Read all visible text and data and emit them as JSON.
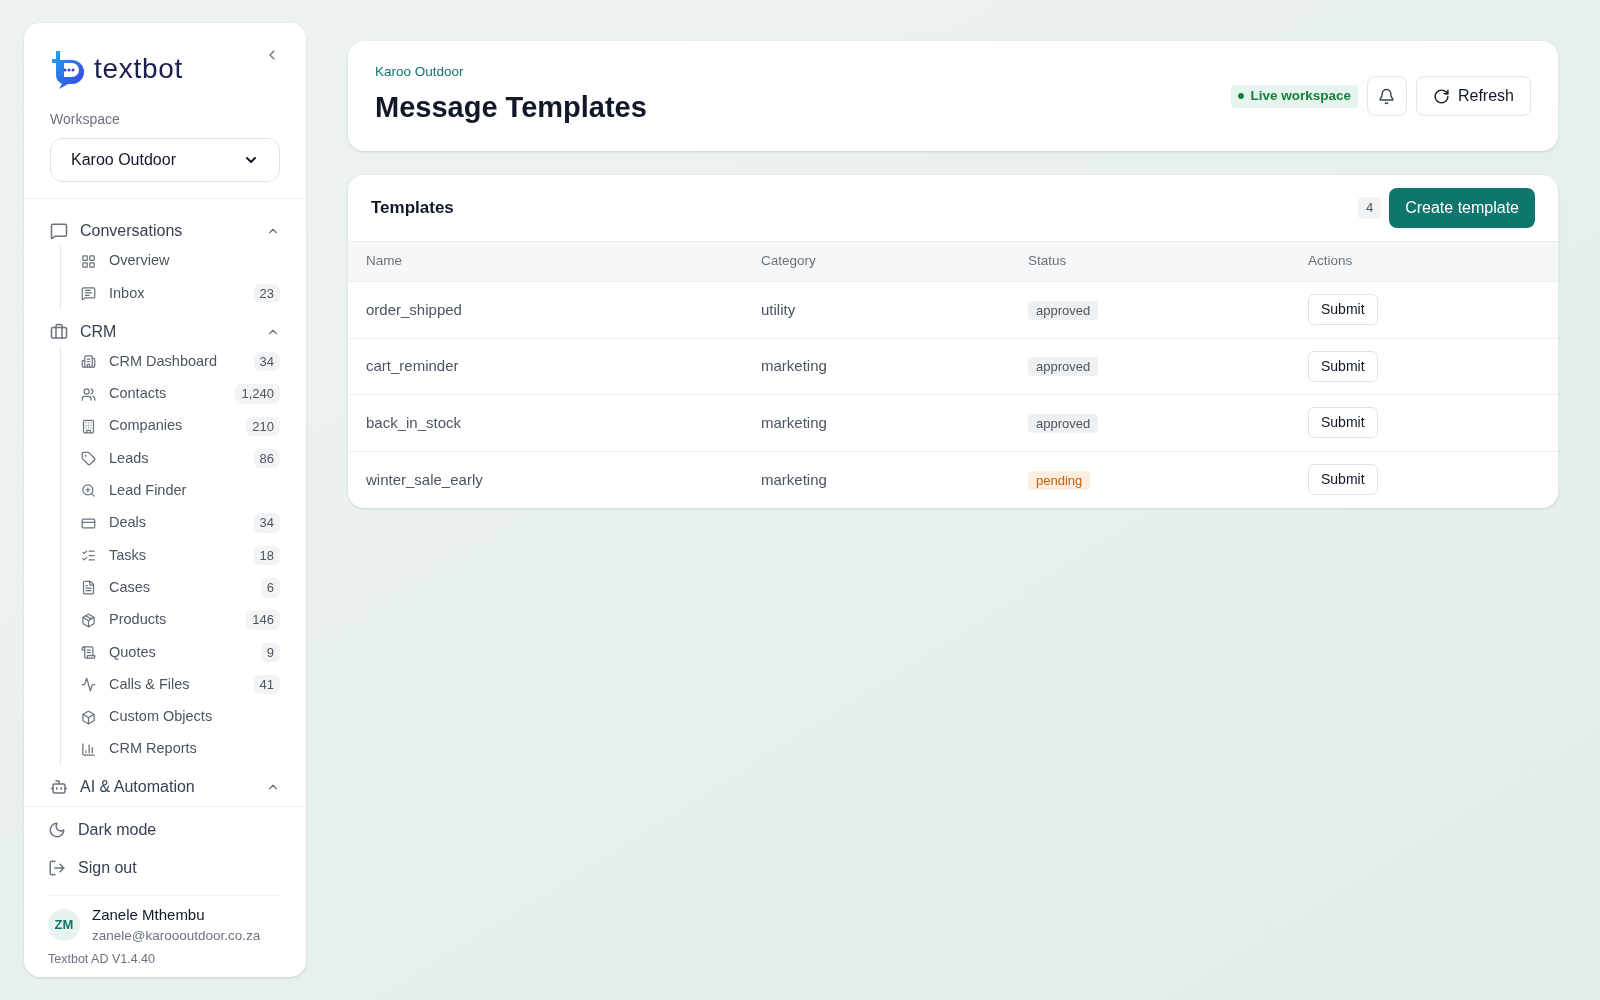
{
  "sidebar": {
    "brand": "textbot",
    "workspace": {
      "label": "Workspace",
      "value": "Karoo Outdoor"
    },
    "groups": [
      {
        "label": "Conversations",
        "expanded": true,
        "items": [
          {
            "label": "Overview"
          },
          {
            "label": "Inbox",
            "count": "23"
          }
        ]
      },
      {
        "label": "CRM",
        "expanded": true,
        "items": [
          {
            "label": "CRM Dashboard",
            "count": "34"
          },
          {
            "label": "Contacts",
            "count": "1,240"
          },
          {
            "label": "Companies",
            "count": "210"
          },
          {
            "label": "Leads",
            "count": "86"
          },
          {
            "label": "Lead Finder"
          },
          {
            "label": "Deals",
            "count": "34"
          },
          {
            "label": "Tasks",
            "count": "18"
          },
          {
            "label": "Cases",
            "count": "6"
          },
          {
            "label": "Products",
            "count": "146"
          },
          {
            "label": "Quotes",
            "count": "9"
          },
          {
            "label": "Calls & Files",
            "count": "41"
          },
          {
            "label": "Custom Objects"
          },
          {
            "label": "CRM Reports"
          }
        ]
      },
      {
        "label": "AI & Automation",
        "expanded": true
      }
    ],
    "actions": [
      "Dark mode",
      "Sign out"
    ],
    "user": {
      "initials": "ZM",
      "name": "Zanele Mthembu",
      "email": "zanele@karoooutdoor.co.za"
    },
    "version": "Textbot AD V1.4.40"
  },
  "header": {
    "breadcrumb": "Karoo Outdoor",
    "title": "Message Templates",
    "status": "Live workspace",
    "refresh": "Refresh"
  },
  "templates": {
    "title": "Templates",
    "count": "4",
    "create": "Create template",
    "columns": [
      "Name",
      "Category",
      "Status",
      "Actions"
    ],
    "rows": [
      {
        "name": "order_shipped",
        "category": "utility",
        "status": {
          "label": "approved",
          "kind": "approved"
        },
        "action": "Submit"
      },
      {
        "name": "cart_reminder",
        "category": "marketing",
        "status": {
          "label": "approved",
          "kind": "approved"
        },
        "action": "Submit"
      },
      {
        "name": "back_in_stock",
        "category": "marketing",
        "status": {
          "label": "approved",
          "kind": "approved"
        },
        "action": "Submit"
      },
      {
        "name": "winter_sale_early",
        "category": "marketing",
        "status": {
          "label": "pending",
          "kind": "pending"
        },
        "action": "Submit"
      }
    ]
  }
}
